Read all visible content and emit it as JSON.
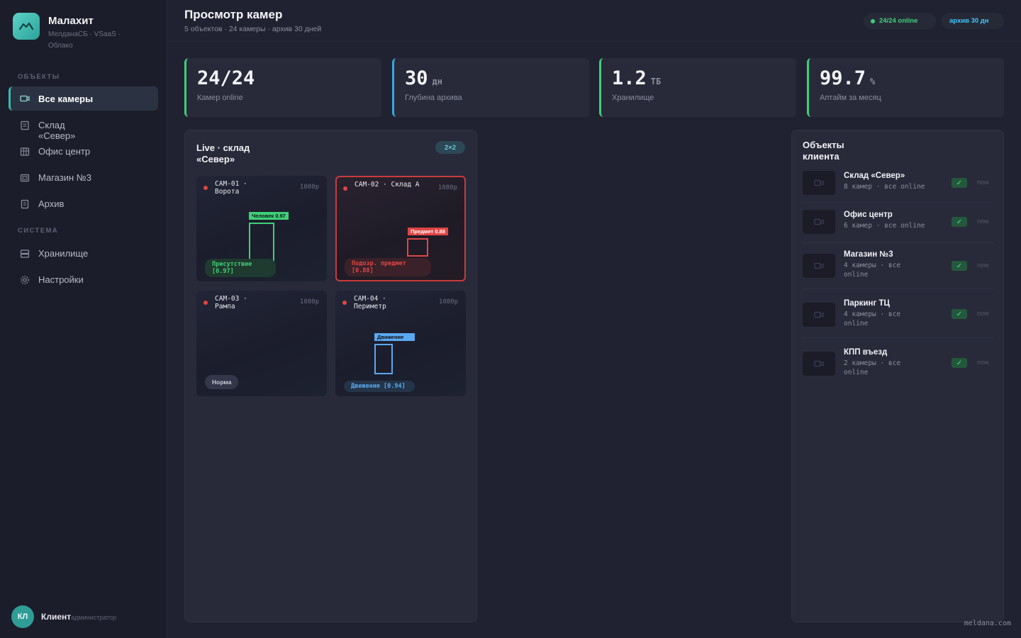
{
  "brand": {
    "name": "Малахит",
    "subtitle": "МелданаСБ · VSaaS · Облако"
  },
  "nav": {
    "section_objects": "ОБЪЕКТЫ",
    "section_system": "СИСТЕМА",
    "items": [
      {
        "label": "Все камеры",
        "icon": "camera-icon",
        "active": true
      },
      {
        "label": "Склад «Север»",
        "icon": "warehouse-icon"
      },
      {
        "label": "Офис центр",
        "icon": "office-icon"
      },
      {
        "label": "Магазин №3",
        "icon": "store-icon"
      },
      {
        "label": "Архив",
        "icon": "archive-icon"
      },
      {
        "label": "Хранилище",
        "icon": "storage-icon"
      },
      {
        "label": "Настройки",
        "icon": "gear-icon"
      }
    ]
  },
  "user": {
    "initials": "КЛ",
    "name": "Клиент",
    "role": "администратор"
  },
  "header": {
    "title": "Просмотр камер",
    "subtitle": "5 объектов · 24 камеры · архив 30 дней",
    "pill_online": "24/24 online",
    "pill_archive": "архив 30 дн"
  },
  "stats": [
    {
      "value": "24/24",
      "unit": "",
      "label": "Камер online",
      "color": "#3fcf77"
    },
    {
      "value": "30",
      "unit": "дн",
      "label": "Глубина архива",
      "color": "#3aa6e0"
    },
    {
      "value": "1.2",
      "unit": "ТБ",
      "label": "Хранилище",
      "color": "#3fcf77"
    },
    {
      "value": "99.7",
      "unit": "%",
      "label": "Аптайм за месяц",
      "color": "#3fcf77"
    }
  ],
  "live": {
    "title": "Live · склад «Север»",
    "grid_badge": "2×2",
    "cameras": [
      {
        "title": "CAM-01 · Ворота",
        "res": "1080p",
        "bbox_label": "Человек 0.97",
        "detection": "Присутствие [0.97]"
      },
      {
        "title": "CAM-02 · Склад А",
        "res": "1080p",
        "bbox_label": "Предмет 0.88",
        "detection": "Подозр. предмет [0.88]"
      },
      {
        "title": "CAM-03 · Рампа",
        "res": "1080p",
        "detection": "Норма"
      },
      {
        "title": "CAM-04 · Периметр",
        "res": "1080p",
        "bbox_label": "Движение",
        "detection": "Движение [0.94]"
      }
    ]
  },
  "objects": {
    "title": "Объекты клиента",
    "items": [
      {
        "name": "Склад «Север»",
        "meta": "8 камер · все online",
        "status": "now"
      },
      {
        "name": "Офис центр",
        "meta": "6 камер · все online",
        "status": "now"
      },
      {
        "name": "Магазин №3",
        "meta": "4 камеры · все online",
        "status": "now"
      },
      {
        "name": "Паркинг ТЦ",
        "meta": "4 камеры · все online",
        "status": "now"
      },
      {
        "name": "КПП въезд",
        "meta": "2 камеры · все online",
        "status": "now"
      }
    ]
  },
  "footer": {
    "brand": "meldana.com"
  }
}
